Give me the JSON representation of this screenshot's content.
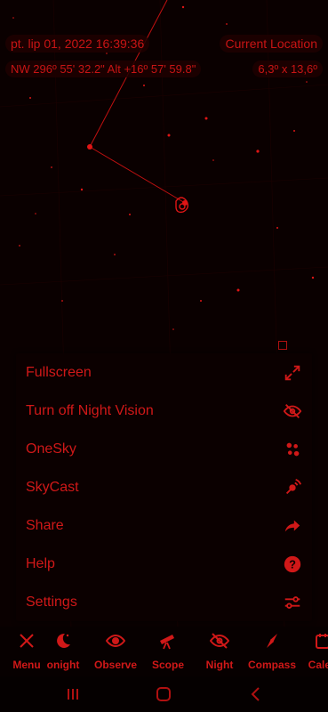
{
  "status": {
    "datetime": "pt. lip 01, 2022  16:39:36",
    "location": "Current Location",
    "coords": "NW 296º 55' 32.2\" Alt +16º 57' 59.8\"",
    "fov": "6,3º x 13,6º"
  },
  "menu": {
    "items": [
      {
        "label": "Fullscreen",
        "icon": "fullscreen-icon"
      },
      {
        "label": "Turn off Night Vision",
        "icon": "eye-off-icon"
      },
      {
        "label": "OneSky",
        "icon": "onesky-icon"
      },
      {
        "label": "SkyCast",
        "icon": "skycast-icon"
      },
      {
        "label": "Share",
        "icon": "share-icon"
      },
      {
        "label": "Help",
        "icon": "help-icon"
      },
      {
        "label": "Settings",
        "icon": "settings-icon"
      }
    ]
  },
  "bottom_bar": {
    "tabs": [
      {
        "label": "Menu",
        "icon": "close-icon"
      },
      {
        "label": "onight",
        "icon": "moon-icon"
      },
      {
        "label": "Observe",
        "icon": "eye-icon"
      },
      {
        "label": "Scope",
        "icon": "telescope-icon"
      },
      {
        "label": "Night",
        "icon": "eye-off-icon"
      },
      {
        "label": "Compass",
        "icon": "compass-icon"
      },
      {
        "label": "Calen",
        "icon": "calendar-icon"
      }
    ]
  },
  "colors": {
    "accent": "#d01818",
    "background": "#060000"
  }
}
